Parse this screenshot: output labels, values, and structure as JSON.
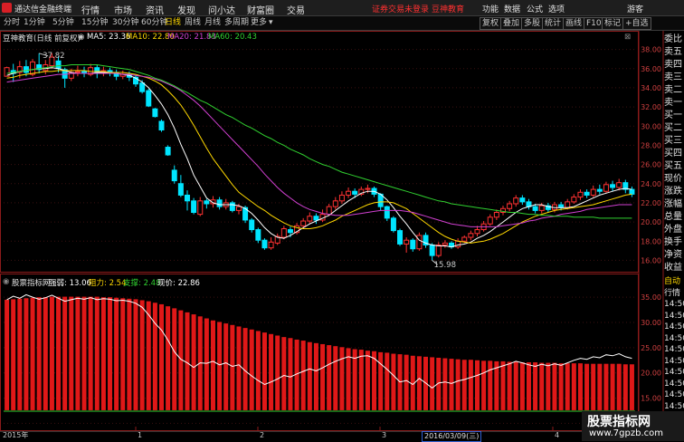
{
  "titlebar": {
    "app_name": "通达信金融终端",
    "menus": [
      "行情",
      "市场",
      "资讯",
      "发现",
      "问小达",
      "财富圈",
      "交易"
    ],
    "status_link": "证券交易未登录",
    "brand_link": "豆神教育",
    "right_menus": [
      "功能",
      "数据",
      "公式",
      "选项"
    ],
    "guest": "游客"
  },
  "toolbar": {
    "periods": [
      "分时",
      "1分钟",
      "5分钟",
      "15分钟",
      "30分钟",
      "60分钟",
      "日线",
      "周线",
      "月线",
      "多周期",
      "更多"
    ],
    "active_period": "日线",
    "right_buttons": [
      "复权",
      "叠加",
      "多股",
      "统计",
      "画线",
      "F10",
      "标记",
      "+自选"
    ]
  },
  "main_chart": {
    "stock_label": "豆神教育(日线 前复权)",
    "ma": [
      {
        "label": "MA5: 23.36",
        "color": "#ffffff"
      },
      {
        "label": "MA10: 22.80",
        "color": "#ffd800"
      },
      {
        "label": "MA20: 21.83",
        "color": "#d040d0"
      },
      {
        "label": "MA60: 20.43",
        "color": "#30d030"
      }
    ],
    "high_marker": "37.82",
    "low_marker": "15.98"
  },
  "indicator_panel": {
    "name": "股票指标网",
    "values": [
      {
        "label": "强弱: 13.06",
        "color": "#ffffff"
      },
      {
        "label": "阻力: 2.54",
        "color": "#ffd800"
      },
      {
        "label": "支撑: 2.48",
        "color": "#30d030"
      },
      {
        "label": "现价: 22.86",
        "color": "#ffffff"
      }
    ]
  },
  "sidebar": {
    "items": [
      "委比",
      "卖五",
      "卖四",
      "卖三",
      "卖二",
      "卖一",
      "买一",
      "买二",
      "买三",
      "买四",
      "买五",
      "现价",
      "涨跌",
      "涨幅",
      "总量",
      "外盘",
      "换手",
      "净资",
      "收益"
    ],
    "lower_items": [
      "自动",
      "行情",
      "14:50",
      "14:50",
      "14:50",
      "14:50",
      "14:50",
      "14:50",
      "14:50",
      "14:50",
      "14:50",
      "14:50"
    ]
  },
  "footer": {
    "dates": [
      "2015年",
      "1",
      "2",
      "3",
      "2016/03/09(三)",
      "4"
    ]
  },
  "watermark": {
    "line1": "股票指标网",
    "line2": "www.7gpzb.com"
  },
  "chart_data": {
    "type": "candlestick",
    "ylim": [
      15.0,
      39.0
    ],
    "yticks": [
      16.0,
      18.0,
      20.0,
      22.0,
      24.0,
      26.0,
      28.0,
      30.0,
      32.0,
      34.0,
      36.0,
      38.0
    ],
    "candles": [
      [
        35.2,
        36.1,
        35.6,
        36.2
      ],
      [
        35.8,
        35.5,
        34.6,
        36.5
      ],
      [
        35.6,
        36.2,
        35.0,
        36.8
      ],
      [
        36.2,
        35.6,
        35.2,
        36.9
      ],
      [
        35.4,
        36.7,
        35.2,
        37.0
      ],
      [
        36.4,
        35.9,
        35.5,
        37.6
      ],
      [
        35.8,
        36.4,
        35.4,
        36.9
      ],
      [
        36.3,
        37.2,
        36.0,
        37.6
      ],
      [
        36.8,
        36.0,
        35.6,
        37.3
      ],
      [
        35.9,
        35.0,
        34.0,
        36.1
      ],
      [
        35.0,
        35.6,
        34.7,
        36.0
      ],
      [
        35.6,
        35.7,
        35.2,
        36.3
      ],
      [
        35.7,
        35.5,
        35.1,
        36.2
      ],
      [
        35.4,
        36.1,
        35.2,
        36.5
      ],
      [
        36.1,
        35.5,
        35.0,
        36.4
      ],
      [
        35.5,
        35.8,
        35.2,
        36.2
      ],
      [
        35.8,
        35.6,
        35.2,
        36.1
      ],
      [
        35.6,
        35.2,
        34.8,
        35.9
      ],
      [
        35.2,
        35.4,
        34.9,
        35.8
      ],
      [
        35.4,
        35.1,
        34.7,
        35.7
      ],
      [
        35.1,
        34.4,
        34.1,
        35.3
      ],
      [
        34.5,
        33.6,
        33.4,
        34.8
      ],
      [
        33.7,
        32.1,
        32.0,
        33.9
      ],
      [
        31.8,
        31.0,
        30.9,
        31.9
      ],
      [
        30.5,
        29.6,
        29.4,
        30.7
      ],
      [
        27.8,
        27.0,
        26.9,
        28.0
      ],
      [
        25.4,
        24.3,
        24.0,
        25.9
      ],
      [
        24.0,
        22.8,
        22.6,
        24.9
      ],
      [
        22.8,
        22.2,
        21.2,
        23.3
      ],
      [
        22.2,
        21.0,
        20.8,
        22.5
      ],
      [
        20.8,
        22.2,
        20.6,
        22.6
      ],
      [
        22.2,
        21.9,
        21.4,
        22.4
      ],
      [
        21.9,
        22.3,
        21.5,
        22.7
      ],
      [
        22.3,
        21.6,
        21.3,
        22.6
      ],
      [
        21.6,
        22.0,
        21.3,
        22.4
      ],
      [
        22.0,
        21.2,
        21.0,
        22.2
      ],
      [
        21.2,
        21.6,
        20.8,
        21.9
      ],
      [
        21.5,
        20.2,
        19.9,
        21.7
      ],
      [
        20.2,
        19.2,
        18.9,
        20.4
      ],
      [
        19.2,
        18.1,
        17.8,
        19.4
      ],
      [
        18.1,
        17.3,
        17.1,
        18.3
      ],
      [
        17.3,
        17.9,
        17.1,
        18.4
      ],
      [
        17.8,
        18.5,
        17.6,
        18.8
      ],
      [
        18.4,
        19.3,
        18.2,
        19.6
      ],
      [
        19.2,
        18.9,
        18.4,
        19.5
      ],
      [
        18.9,
        19.6,
        18.7,
        19.9
      ],
      [
        19.6,
        20.1,
        19.3,
        20.4
      ],
      [
        20.1,
        20.6,
        19.8,
        21.0
      ],
      [
        20.6,
        20.2,
        19.8,
        20.9
      ],
      [
        20.2,
        20.8,
        20.0,
        21.3
      ],
      [
        20.8,
        21.6,
        20.6,
        21.9
      ],
      [
        21.6,
        22.2,
        21.3,
        22.6
      ],
      [
        22.2,
        22.8,
        21.9,
        23.2
      ],
      [
        22.8,
        23.2,
        22.5,
        23.6
      ],
      [
        23.2,
        22.9,
        22.5,
        23.5
      ],
      [
        22.9,
        23.4,
        22.7,
        23.7
      ],
      [
        23.4,
        23.5,
        23.0,
        23.9
      ],
      [
        23.5,
        22.9,
        22.6,
        23.7
      ],
      [
        22.9,
        21.6,
        21.2,
        23.0
      ],
      [
        21.6,
        20.4,
        20.1,
        21.7
      ],
      [
        20.4,
        19.1,
        18.9,
        20.6
      ],
      [
        19.1,
        17.7,
        17.5,
        19.3
      ],
      [
        17.7,
        18.1,
        16.8,
        18.4
      ],
      [
        18.1,
        17.2,
        16.9,
        18.3
      ],
      [
        17.2,
        18.6,
        17.0,
        18.9
      ],
      [
        18.6,
        17.6,
        17.3,
        18.9
      ],
      [
        17.6,
        16.5,
        16.0,
        17.8
      ],
      [
        16.5,
        17.6,
        16.3,
        17.9
      ],
      [
        17.6,
        17.8,
        17.3,
        18.1
      ],
      [
        17.8,
        17.4,
        17.2,
        18.0
      ],
      [
        17.4,
        18.0,
        17.2,
        18.3
      ],
      [
        18.0,
        18.4,
        17.8,
        18.6
      ],
      [
        18.4,
        18.8,
        18.1,
        19.1
      ],
      [
        18.8,
        19.2,
        18.5,
        19.6
      ],
      [
        19.2,
        19.8,
        19.0,
        20.1
      ],
      [
        19.8,
        20.5,
        19.6,
        20.8
      ],
      [
        20.5,
        21.0,
        20.2,
        21.3
      ],
      [
        21.0,
        21.4,
        20.7,
        21.7
      ],
      [
        21.4,
        21.9,
        21.1,
        22.2
      ],
      [
        21.9,
        22.5,
        21.6,
        22.8
      ],
      [
        22.5,
        22.1,
        21.8,
        22.8
      ],
      [
        22.1,
        21.6,
        21.3,
        22.4
      ],
      [
        21.6,
        21.2,
        20.9,
        21.9
      ],
      [
        21.2,
        21.7,
        20.9,
        22.0
      ],
      [
        21.7,
        21.3,
        21.0,
        22.0
      ],
      [
        21.3,
        21.8,
        21.0,
        22.1
      ],
      [
        21.8,
        21.5,
        21.2,
        22.1
      ],
      [
        21.5,
        22.1,
        21.3,
        22.4
      ],
      [
        22.1,
        22.6,
        21.9,
        22.9
      ],
      [
        22.6,
        23.1,
        22.3,
        23.4
      ],
      [
        23.1,
        22.8,
        22.5,
        23.4
      ],
      [
        22.8,
        23.4,
        22.6,
        23.8
      ],
      [
        23.4,
        23.2,
        22.9,
        23.9
      ],
      [
        23.2,
        23.9,
        23.0,
        24.2
      ],
      [
        23.9,
        23.6,
        23.2,
        24.3
      ],
      [
        23.6,
        24.1,
        23.3,
        24.5
      ],
      [
        24.1,
        23.4,
        23.0,
        24.4
      ],
      [
        23.4,
        22.9,
        22.6,
        23.7
      ]
    ],
    "ma_series": [
      {
        "name": "MA5",
        "color": "#ffffff",
        "values": [
          35.3,
          35.5,
          35.7,
          35.8,
          35.9,
          36.0,
          36.0,
          36.1,
          36.0,
          35.8,
          35.6,
          35.5,
          35.5,
          35.5,
          35.6,
          35.6,
          35.6,
          35.5,
          35.4,
          35.3,
          35.0,
          34.6,
          34.0,
          33.2,
          32.3,
          31.2,
          29.8,
          28.1,
          26.6,
          24.9,
          23.7,
          22.5,
          22.0,
          21.8,
          21.8,
          21.8,
          21.7,
          21.4,
          20.9,
          20.2,
          19.4,
          18.8,
          18.4,
          18.3,
          18.6,
          19.0,
          19.4,
          19.8,
          20.1,
          20.4,
          20.7,
          21.2,
          21.7,
          22.2,
          22.6,
          23.0,
          23.2,
          23.2,
          22.9,
          22.3,
          21.5,
          20.6,
          19.8,
          18.9,
          18.1,
          17.8,
          17.6,
          17.5,
          17.5,
          17.4,
          17.6,
          17.7,
          17.9,
          18.3,
          18.6,
          19.0,
          19.5,
          20.0,
          20.5,
          21.0,
          21.4,
          21.6,
          21.8,
          21.8,
          21.6,
          21.5,
          21.5,
          21.5,
          21.6,
          21.9,
          22.2,
          22.5,
          22.8,
          23.0,
          23.2,
          23.4,
          23.5,
          23.4
        ]
      },
      {
        "name": "MA10",
        "color": "#ffd800",
        "values": [
          35.0,
          35.1,
          35.3,
          35.4,
          35.5,
          35.6,
          35.7,
          35.7,
          35.8,
          35.8,
          35.8,
          35.8,
          35.8,
          35.7,
          35.7,
          35.7,
          35.6,
          35.6,
          35.6,
          35.5,
          35.4,
          35.2,
          35.0,
          34.7,
          34.3,
          33.7,
          33.0,
          32.2,
          31.2,
          30.1,
          28.9,
          27.7,
          26.6,
          25.7,
          24.8,
          23.9,
          23.1,
          22.6,
          22.1,
          21.6,
          21.2,
          20.7,
          20.3,
          19.9,
          19.6,
          19.4,
          19.3,
          19.3,
          19.4,
          19.6,
          19.9,
          20.2,
          20.6,
          20.9,
          21.2,
          21.5,
          21.8,
          22.0,
          22.1,
          22.1,
          22.0,
          21.7,
          21.4,
          20.9,
          20.4,
          19.9,
          19.4,
          18.9,
          18.5,
          18.2,
          18.0,
          17.9,
          17.8,
          17.9,
          18.0,
          18.2,
          18.5,
          18.8,
          19.2,
          19.6,
          20.0,
          20.3,
          20.6,
          20.8,
          21.0,
          21.2,
          21.3,
          21.4,
          21.5,
          21.6,
          21.7,
          21.8,
          22.0,
          22.2,
          22.4,
          22.6,
          22.8,
          22.9
        ]
      },
      {
        "name": "MA20",
        "color": "#d040d0",
        "values": [
          34.6,
          34.7,
          34.8,
          34.9,
          35.0,
          35.1,
          35.2,
          35.3,
          35.4,
          35.4,
          35.5,
          35.5,
          35.5,
          35.5,
          35.5,
          35.5,
          35.5,
          35.5,
          35.4,
          35.4,
          35.3,
          35.2,
          35.1,
          34.9,
          34.7,
          34.4,
          34.1,
          33.7,
          33.2,
          32.7,
          32.1,
          31.4,
          30.7,
          30.0,
          29.3,
          28.6,
          27.9,
          27.2,
          26.5,
          25.8,
          25.0,
          24.3,
          23.6,
          23.0,
          22.5,
          22.0,
          21.6,
          21.3,
          21.1,
          20.9,
          20.8,
          20.7,
          20.7,
          20.7,
          20.8,
          20.9,
          21.0,
          21.1,
          21.2,
          21.2,
          21.2,
          21.2,
          21.1,
          21.0,
          20.8,
          20.6,
          20.4,
          20.2,
          20.0,
          19.8,
          19.7,
          19.6,
          19.5,
          19.5,
          19.5,
          19.5,
          19.5,
          19.6,
          19.7,
          19.8,
          19.9,
          20.1,
          20.2,
          20.4,
          20.5,
          20.6,
          20.8,
          20.9,
          21.0,
          21.1,
          21.3,
          21.4,
          21.5,
          21.6,
          21.7,
          21.8,
          21.8,
          21.8
        ]
      },
      {
        "name": "MA60",
        "color": "#30d030",
        "values": [
          35.5,
          35.6,
          35.7,
          35.8,
          35.9,
          36.0,
          36.1,
          36.2,
          36.3,
          36.3,
          36.4,
          36.4,
          36.4,
          36.4,
          36.4,
          36.3,
          36.2,
          36.1,
          36.0,
          35.9,
          35.7,
          35.5,
          35.3,
          35.0,
          34.8,
          34.5,
          34.2,
          33.8,
          33.5,
          33.1,
          32.7,
          32.4,
          32.0,
          31.6,
          31.2,
          30.9,
          30.5,
          30.1,
          29.8,
          29.4,
          29.0,
          28.7,
          28.3,
          28.0,
          27.6,
          27.3,
          27.0,
          26.6,
          26.3,
          26.0,
          25.8,
          25.5,
          25.2,
          25.0,
          24.8,
          24.6,
          24.4,
          24.2,
          24.0,
          23.8,
          23.6,
          23.4,
          23.2,
          23.0,
          22.8,
          22.6,
          22.4,
          22.2,
          22.1,
          21.9,
          21.8,
          21.7,
          21.6,
          21.5,
          21.4,
          21.3,
          21.2,
          21.1,
          21.0,
          21.0,
          20.9,
          20.8,
          20.8,
          20.7,
          20.7,
          20.6,
          20.6,
          20.6,
          20.5,
          20.5,
          20.5,
          20.5,
          20.4,
          20.4,
          20.4,
          20.4,
          20.4,
          20.4
        ]
      }
    ],
    "indicator": {
      "ylim": [
        9.0,
        37.0
      ],
      "yticks": [
        10.0,
        15.0,
        20.0,
        25.0,
        30.0,
        35.0
      ],
      "bar_top": [
        34.5,
        34.6,
        34.7,
        34.8,
        34.9,
        35.0,
        35.0,
        35.1,
        35.1,
        35.1,
        35.1,
        35.1,
        35.1,
        35.1,
        35.1,
        35.0,
        35.0,
        34.9,
        34.8,
        34.7,
        34.6,
        34.4,
        34.2,
        33.9,
        33.6,
        33.2,
        32.8,
        32.4,
        32.0,
        31.6,
        31.2,
        30.8,
        30.4,
        30.1,
        29.8,
        29.5,
        29.2,
        28.9,
        28.6,
        28.3,
        28.0,
        27.7,
        27.4,
        27.1,
        26.9,
        26.6,
        26.4,
        26.1,
        25.9,
        25.7,
        25.5,
        25.3,
        25.1,
        24.9,
        24.7,
        24.6,
        24.4,
        24.3,
        24.1,
        24.0,
        23.8,
        23.7,
        23.6,
        23.4,
        23.3,
        23.2,
        23.1,
        23.0,
        22.9,
        22.8,
        22.7,
        22.6,
        22.6,
        22.5,
        22.4,
        22.4,
        22.3,
        22.3,
        22.2,
        22.2,
        22.1,
        22.1,
        22.1,
        22.0,
        22.0,
        22.0,
        21.9,
        21.9,
        21.9,
        21.9,
        21.8,
        21.8,
        21.8,
        21.8,
        21.8,
        21.8,
        21.7,
        21.7
      ],
      "bar_bottom": 12.6,
      "price_line": [
        34.5,
        35.2,
        34.8,
        35.5,
        35.0,
        34.6,
        34.9,
        35.4,
        34.8,
        34.2,
        34.5,
        34.8,
        34.6,
        34.9,
        34.5,
        34.7,
        34.6,
        34.3,
        34.4,
        34.2,
        33.8,
        33.0,
        31.5,
        29.8,
        28.5,
        26.5,
        24.2,
        22.7,
        22.0,
        21.1,
        22.0,
        21.9,
        22.3,
        21.6,
        22.0,
        21.3,
        21.6,
        20.4,
        19.4,
        18.5,
        17.7,
        18.2,
        18.8,
        19.5,
        19.2,
        19.8,
        20.3,
        20.8,
        20.4,
        21.0,
        21.7,
        22.3,
        22.8,
        23.2,
        22.9,
        23.3,
        23.4,
        22.9,
        21.8,
        20.7,
        19.5,
        18.2,
        18.5,
        17.7,
        18.9,
        18.0,
        17.0,
        18.0,
        18.2,
        17.9,
        18.4,
        18.7,
        19.1,
        19.5,
        20.0,
        20.6,
        21.0,
        21.4,
        21.8,
        22.3,
        22.0,
        21.6,
        21.3,
        21.7,
        21.4,
        21.8,
        21.5,
        22.0,
        22.5,
        22.9,
        22.7,
        23.2,
        23.0,
        23.6,
        23.4,
        23.8,
        23.2,
        22.9
      ]
    }
  }
}
